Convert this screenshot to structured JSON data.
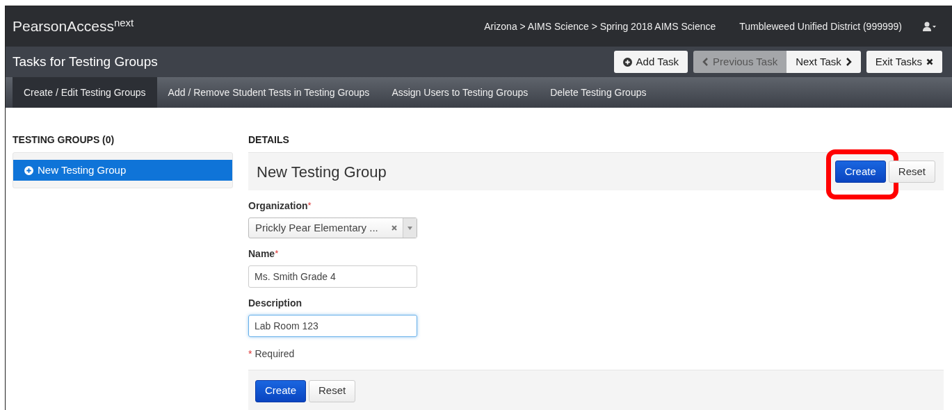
{
  "header": {
    "brand": "PearsonAccess",
    "brand_sup": "next",
    "breadcrumb": "Arizona > AIMS Science > Spring 2018 AIMS Science",
    "organization": "Tumbleweed Unified District (999999)"
  },
  "task_bar": {
    "title": "Tasks for Testing Groups",
    "buttons": [
      {
        "label": "Add Task",
        "kind": "add",
        "disabled": false
      },
      {
        "label": "Previous Task",
        "kind": "prev",
        "disabled": true
      },
      {
        "label": "Next Task",
        "kind": "next",
        "disabled": false
      },
      {
        "label": "Exit Tasks",
        "kind": "exit",
        "disabled": false
      }
    ]
  },
  "tabs": [
    {
      "label": "Create / Edit Testing Groups",
      "selected": true
    },
    {
      "label": "Add / Remove Student Tests in Testing Groups",
      "selected": false
    },
    {
      "label": "Assign Users to Testing Groups",
      "selected": false
    },
    {
      "label": "Delete Testing Groups",
      "selected": false
    }
  ],
  "sidebar": {
    "heading": "TESTING GROUPS (0)",
    "items": [
      {
        "label": "New Testing Group",
        "selected": true
      }
    ]
  },
  "details": {
    "heading": "DETAILS",
    "title": "New Testing Group",
    "top_buttons": [
      {
        "label": "Create",
        "kind": "primary",
        "highlighted": true
      },
      {
        "label": "Reset",
        "kind": "default",
        "highlighted": false
      }
    ],
    "fields": [
      {
        "label": "Organization",
        "required": true,
        "kind": "select",
        "value": "Prickly Pear Elementary ..."
      },
      {
        "label": "Name",
        "required": true,
        "kind": "text",
        "value": "Ms. Smith Grade 4",
        "focused": false
      },
      {
        "label": "Description",
        "required": false,
        "kind": "text",
        "value": "Lab Room 123",
        "focused": true
      }
    ],
    "required_mark": "*",
    "required_note": "Required",
    "bottom_buttons": [
      {
        "label": "Create",
        "kind": "primary"
      },
      {
        "label": "Reset",
        "kind": "default"
      }
    ]
  }
}
